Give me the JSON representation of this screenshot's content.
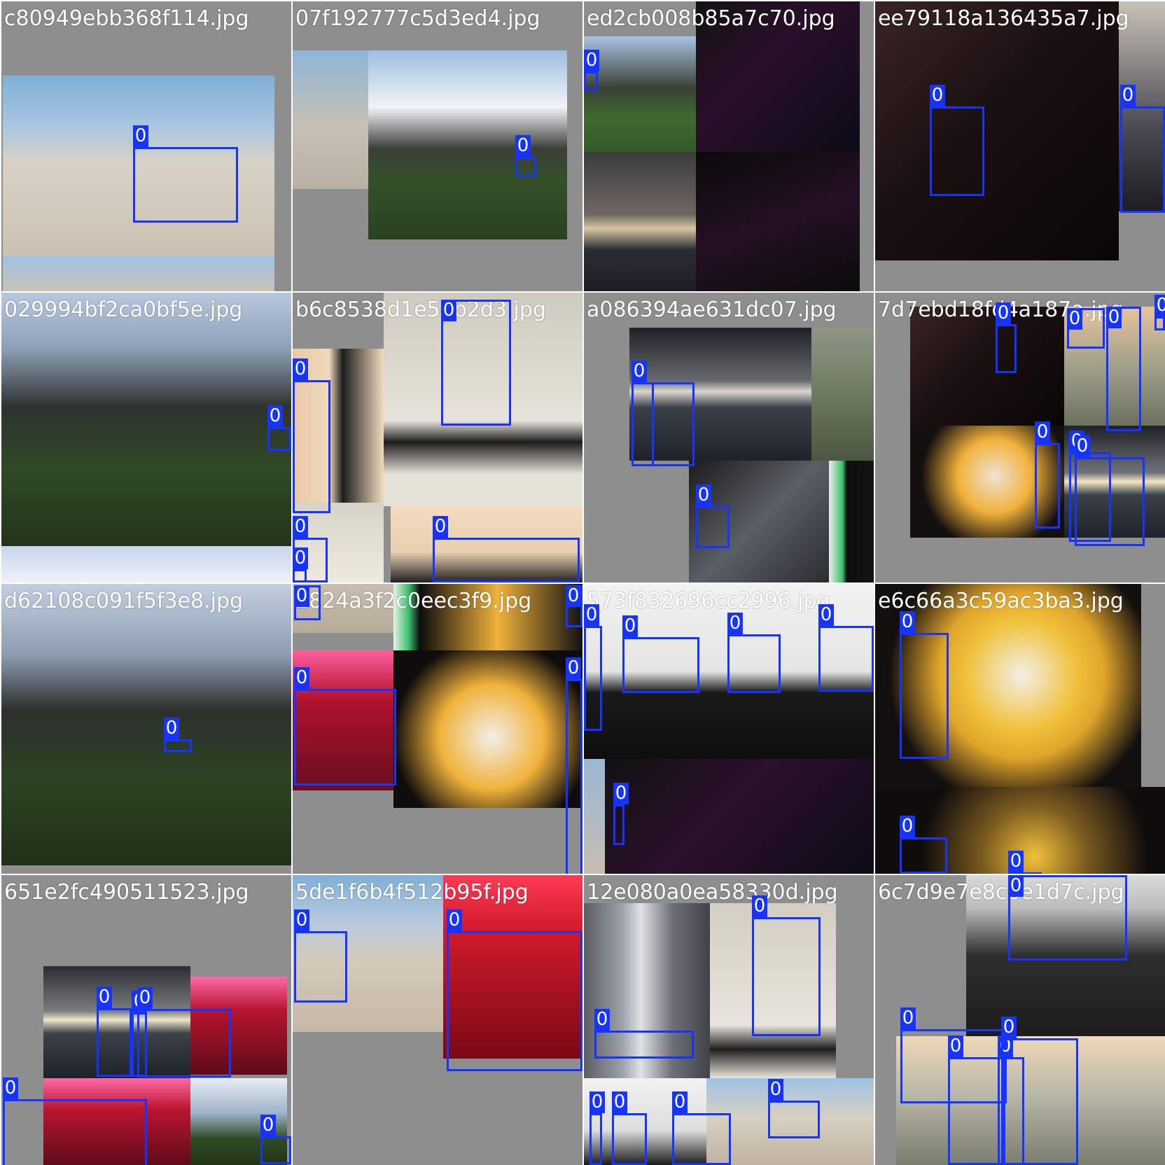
{
  "grid_title": "",
  "colors": {
    "box": "#1733ff",
    "tag_text": "#ffffff",
    "pad": "#8e8e8e",
    "divider": "#ffffff"
  },
  "tiles": [
    {
      "filename": "c80949ebb368f114.jpg",
      "photos": [
        {
          "scene": "desert-camp",
          "color": "linear-gradient(#7fb0d8 0%, #a9c6e0 28%, #d8d2c6 48%, #cbc1b2 100%)"
        },
        {
          "scene": "desert-camp-strip",
          "color": "linear-gradient(#9cc3e6,#c9c1b5)"
        }
      ],
      "boxes": [
        {
          "label": "0"
        }
      ]
    },
    {
      "filename": "07f192777c5d3ed4.jpg",
      "photos": [
        {
          "scene": "poster-crop",
          "color": "linear-gradient(#d7d2c4,#ece8de)"
        },
        {
          "scene": "desert-crop",
          "color": "linear-gradient(#8db6da 0%, #c7c0b4 55%, #b9b0a2 100%)"
        },
        {
          "scene": "stadium",
          "color": "linear-gradient(#9ebde3 0%, #f2f4f7 30%, #3b3f38 52%, #34512a 70%, #2b4020 100%)"
        }
      ],
      "boxes": [
        {
          "label": "0"
        }
      ]
    },
    {
      "filename": "ed2cb008b85a7c70.jpg",
      "photos": [
        {
          "scene": "stadium-small",
          "color": "linear-gradient(#a9c3e4 0%, #3a4036 45%, #3f6a2c 70%, #35592a 100%)"
        },
        {
          "scene": "stage-lights",
          "color": "linear-gradient(135deg,#121212 0%, #2a0f2a 40%, #0c0c16 100%)"
        },
        {
          "scene": "sunset-sea",
          "color": "linear-gradient(#3a3b3d 0%, #6f6760 45%, #d8c7a0 55%, #2a2d33 70%, #1c1f25 100%)"
        },
        {
          "scene": "stage-lights-2",
          "color": "linear-gradient(160deg,#0a0a0a 0%, #241024 50%, #0b0b0b 100%)"
        }
      ],
      "boxes": [
        {
          "label": "0"
        }
      ]
    },
    {
      "filename": "ee79118a136435a7.jpg",
      "photos": [
        {
          "scene": "dark-room",
          "color": "linear-gradient(135deg,#3b2424 0%, #1a1010 45%, #0b0606 100%)"
        },
        {
          "scene": "suit-person",
          "color": "linear-gradient(#c9c2b6 0%, #4a4a52 60%, #1c1c22 100%)"
        }
      ],
      "boxes": [
        {
          "label": "0"
        },
        {
          "label": "0"
        }
      ]
    },
    {
      "filename": "029994bf2ca0bf5e.jpg",
      "photos": [
        {
          "scene": "stadium-wide",
          "color": "linear-gradient(#b8c8de 0%, #8da0b8 22%, #2f3330 45%, #2f4a25 70%, #223419 100%)"
        },
        {
          "scene": "sky-strip",
          "color": "linear-gradient(#c6d6ea,#eef2f8)"
        }
      ],
      "boxes": [
        {
          "label": "0"
        }
      ]
    },
    {
      "filename": "b6c8538d1e54b2d3.jpg",
      "photos": [
        {
          "scene": "podium-speaker",
          "color": "linear-gradient(90deg,#e9c9a6 0%, #f1d9bc 40%, #1c1c1c 55%, #f2dcc0 100%)"
        },
        {
          "scene": "poster",
          "color": "linear-gradient(#cfcac0 0%, #e7e3da 60%, #1d1d1d 70%, #e6e2d8 85%)"
        },
        {
          "scene": "poster-crop",
          "color": "linear-gradient(#d8d3c8,#eeeae1)"
        },
        {
          "scene": "speaker-mic",
          "color": "linear-gradient(#f3dcc0 0%, #e9cfb0 60%, #202020 100%)"
        }
      ],
      "boxes": [
        {
          "label": "0"
        },
        {
          "label": "0"
        },
        {
          "label": "0"
        },
        {
          "label": "0"
        },
        {
          "label": "0"
        },
        {
          "label": "0"
        }
      ]
    },
    {
      "filename": "a086394ae631dc07.jpg",
      "photos": [
        {
          "scene": "sunset-silhouette",
          "color": "linear-gradient(#1e2126 0%, #676b70 40%, #d9d7cf 48%, #3b4048 60%, #1f2329 100%)"
        },
        {
          "scene": "trees",
          "color": "linear-gradient(#8f9685 0%, #6d7a60 50%, #4a563f 100%)"
        },
        {
          "scene": "book-cover",
          "color": "linear-gradient(135deg,#1b1b1b 0%, #5a5f66 50%, #2a2d32 100%)"
        },
        {
          "scene": "green-strip",
          "color": "linear-gradient(90deg,#eeeeee 0%, #3bbf6b 30%, #0e0e0e 40%, #141414 100%)"
        }
      ],
      "boxes": [
        {
          "label": "0"
        },
        {
          "label": "0"
        },
        {
          "label": "0"
        }
      ]
    },
    {
      "filename": "7d7ebd18fd4a187a.jpg",
      "photos": [
        {
          "scene": "dark-room",
          "color": "linear-gradient(135deg,#3b2424 0%, #1a1010 45%, #0b0606 100%)"
        },
        {
          "scene": "soldiers",
          "color": "linear-gradient(#e8c49d 0%, #9a9c88 55%, #6e705f 100%)"
        },
        {
          "scene": "chicken-costume",
          "color": "radial-gradient(circle at 55% 45%,#f0e2d5 0%, #f1b23a 35%, #151010 70%)"
        },
        {
          "scene": "sunset-silhouette",
          "color": "linear-gradient(#1e2126 0%, #6f7277 42%, #f2e7c2 50%, #3a4048 62%, #1f2329 100%)"
        }
      ],
      "boxes": [
        {
          "label": "0"
        },
        {
          "label": "0"
        },
        {
          "label": "0"
        },
        {
          "label": "0"
        },
        {
          "label": "0"
        },
        {
          "label": "0"
        },
        {
          "label": "0"
        }
      ]
    },
    {
      "filename": "d62108c091f5f3e8.jpg",
      "photos": [
        {
          "scene": "stadium-wide",
          "color": "linear-gradient(#c2cfe0 0%, #8e9db2 25%, #2c302d 45%, #2c4423 70%, #1f3017 100%)"
        }
      ],
      "boxes": [
        {
          "label": "0"
        }
      ]
    },
    {
      "filename": "2824a3f2c0eec3f9.jpg",
      "photos": [
        {
          "scene": "desert-crop",
          "color": "linear-gradient(#c8bdae,#b7ab9a)"
        },
        {
          "scene": "chicken-top",
          "color": "linear-gradient(90deg,#e8f3ea 0%, #3bbf6b 8%, #0d0d0d 14%, #f1b23a 55%, #121212 100%)"
        },
        {
          "scene": "crowd-red",
          "color": "linear-gradient(#ff5fa0 0%, #b0122f 35%, #6a0d1e 100%)"
        },
        {
          "scene": "chicken-costume",
          "color": "radial-gradient(circle at 52% 55%,#f2efe8 0%, #f1b23a 40%, #0e0c0c 75%)"
        }
      ],
      "boxes": [
        {
          "label": "0"
        },
        {
          "label": "0"
        },
        {
          "label": "0"
        },
        {
          "label": "0"
        }
      ]
    },
    {
      "filename": "573f832696cc2996.jpg",
      "photos": [
        {
          "scene": "panel",
          "color": "linear-gradient(#f2f2f2 0%, #e4e4e4 50%, #1a1a1a 62%, #0e0e0e 100%)"
        },
        {
          "scene": "stage-lights",
          "color": "linear-gradient(135deg,#121212 0%, #2b102b 45%, #0c0c16 100%)"
        },
        {
          "scene": "desert-crop",
          "color": "linear-gradient(#9bb7d5,#c6bdb0)"
        }
      ],
      "boxes": [
        {
          "label": "0"
        },
        {
          "label": "0"
        },
        {
          "label": "0"
        },
        {
          "label": "0"
        },
        {
          "label": "0"
        }
      ]
    },
    {
      "filename": "e6c66a3c59ac3ba3.jpg",
      "photos": [
        {
          "scene": "chicken-costume",
          "color": "radial-gradient(circle at 55% 45%,#f2efe8 0%, #f1c13a 30%, #e0a42a 45%, #120f0f 72%)"
        },
        {
          "scene": "chicken-costume-2",
          "color": "radial-gradient(circle at 55% 80%,#f1c13a 0%, #7a5a20 30%, #0f0c0c 65%)"
        }
      ],
      "boxes": [
        {
          "label": "0"
        },
        {
          "label": "0"
        },
        {
          "label": "0"
        }
      ]
    },
    {
      "filename": "651e2fc490511523.jpg",
      "photos": [
        {
          "scene": "sunset-silhouette",
          "color": "linear-gradient(#2b2e33 0%, #7a7c7e 40%, #efe6c8 48%, #3c424a 60%, #1e2228 100%)"
        },
        {
          "scene": "crowd-red",
          "color": "linear-gradient(#ff6aa6 0%, #b5142e 35%, #5e0b19 100%)"
        },
        {
          "scene": "crowd-red-2",
          "color": "linear-gradient(#ff6aa6 0%, #bd1530 35%, #5e0b19 100%)"
        },
        {
          "scene": "stadium-small",
          "color": "linear-gradient(#e8eef7 0%, #9fb3c9 40%, #2f4a25 70%, #213518 100%)"
        }
      ],
      "boxes": [
        {
          "label": "0"
        },
        {
          "label": "0"
        },
        {
          "label": "0"
        },
        {
          "label": "0"
        },
        {
          "label": "0"
        }
      ]
    },
    {
      "filename": "5de1f6b4f512b95f.jpg",
      "photos": [
        {
          "scene": "desert-camp",
          "color": "linear-gradient(#7fb0d8 0%, #b8c9dd 30%, #d4cabb 55%, #c4b8a6 100%)"
        },
        {
          "scene": "crowd-red",
          "color": "linear-gradient(#ff3a55 0%, #d11a2b 30%, #7a0915 100%)"
        }
      ],
      "boxes": [
        {
          "label": "0"
        },
        {
          "label": "0"
        }
      ]
    },
    {
      "filename": "12e080a0ea58330d.jpg",
      "photos": [
        {
          "scene": "city-street",
          "color": "linear-gradient(90deg,#5b5e63 0%, #9aa0a8 30%, #dfe2e6 45%, #6d7177 70%, #3f4247 100%)"
        },
        {
          "scene": "poster",
          "color": "linear-gradient(#d3cec4 0%, #e8e4db 60%, #1e1e1e 72%, #e6e2d8 86%)"
        },
        {
          "scene": "panel-small",
          "color": "linear-gradient(#f2f2f2 0%, #dedede 60%, #1a1a1a 100%)"
        },
        {
          "scene": "desert-camp-small",
          "color": "linear-gradient(#9cc3e6 0%, #d7d0c2 45%, #bfb3a1 100%)"
        }
      ],
      "boxes": [
        {
          "label": "0"
        },
        {
          "label": "0"
        },
        {
          "label": "0"
        },
        {
          "label": "0"
        },
        {
          "label": "0"
        },
        {
          "label": "0"
        }
      ]
    },
    {
      "filename": "6c7d9e7e8c6e1d7c.jpg",
      "photos": [
        {
          "scene": "chef-grill",
          "color": "linear-gradient(#d9d9d9 0%, #bdbdbd 20%, #2e2e2e 50%, #1c1c1c 100%)"
        },
        {
          "scene": "soldiers",
          "color": "linear-gradient(#f0d7b8 0%, #b8b8a8 45%, #7a7c6e 100%)"
        }
      ],
      "boxes": [
        {
          "label": "0"
        },
        {
          "label": "0"
        },
        {
          "label": "0"
        },
        {
          "label": "0"
        },
        {
          "label": "0"
        }
      ]
    }
  ]
}
